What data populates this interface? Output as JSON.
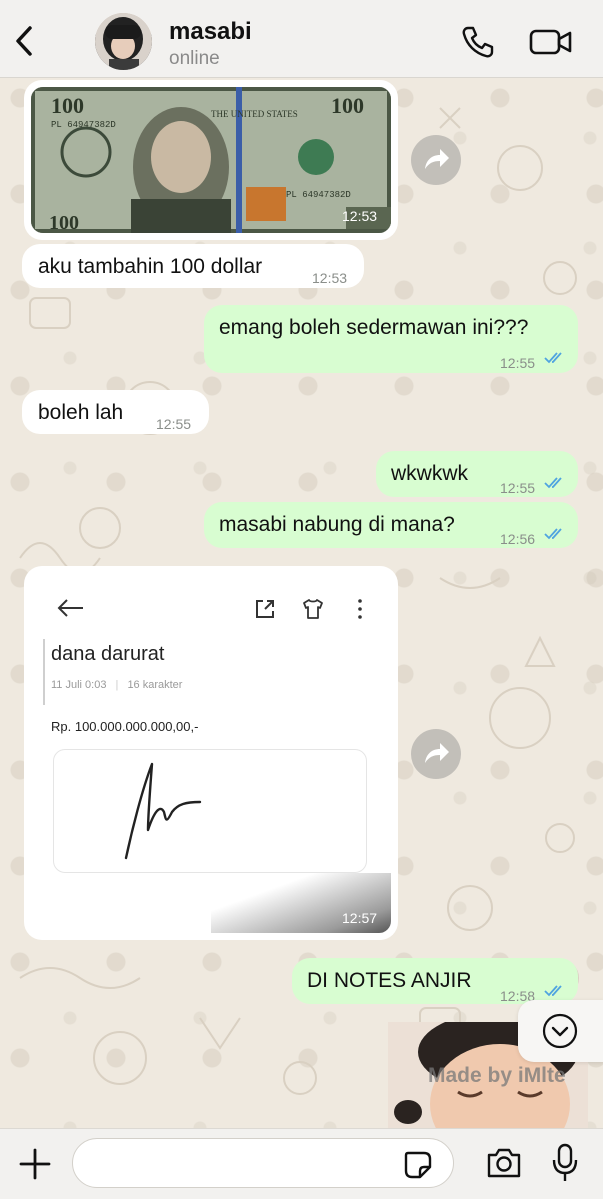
{
  "header": {
    "contact_name": "masabi",
    "status": "online"
  },
  "messages": [
    {
      "type": "image",
      "side": "in",
      "image": "hundred-dollar-bill",
      "time": "12:53"
    },
    {
      "type": "text",
      "side": "in",
      "text": "aku tambahin 100 dollar",
      "time": "12:53"
    },
    {
      "type": "text",
      "side": "out",
      "text": "emang boleh sedermawan ini???",
      "time": "12:55",
      "status": "read"
    },
    {
      "type": "text",
      "side": "in",
      "text": "boleh lah",
      "time": "12:55"
    },
    {
      "type": "text",
      "side": "out",
      "text": "wkwkwk",
      "time": "12:55",
      "status": "read"
    },
    {
      "type": "text",
      "side": "out",
      "text": "masabi nabung di mana?",
      "time": "12:56",
      "status": "read"
    },
    {
      "type": "image",
      "side": "in",
      "image": "notes-screenshot",
      "time": "12:57",
      "notes": {
        "title": "dana darurat",
        "date": "11 Juli 0:03",
        "chars": "16 karakter",
        "body": "Rp. 100.000.000.000,00,-"
      }
    },
    {
      "type": "text",
      "side": "out",
      "text": "DI NOTES ANJIR",
      "time": "12:58",
      "status": "read"
    }
  ],
  "sticker": {
    "watermark": "Made by iMlte"
  },
  "composer": {
    "placeholder": ""
  },
  "colors": {
    "incoming": "#ffffff",
    "outgoing": "#d8fdd1",
    "read_ticks": "#4fa3e0",
    "header_bg": "#f2f1ef"
  }
}
